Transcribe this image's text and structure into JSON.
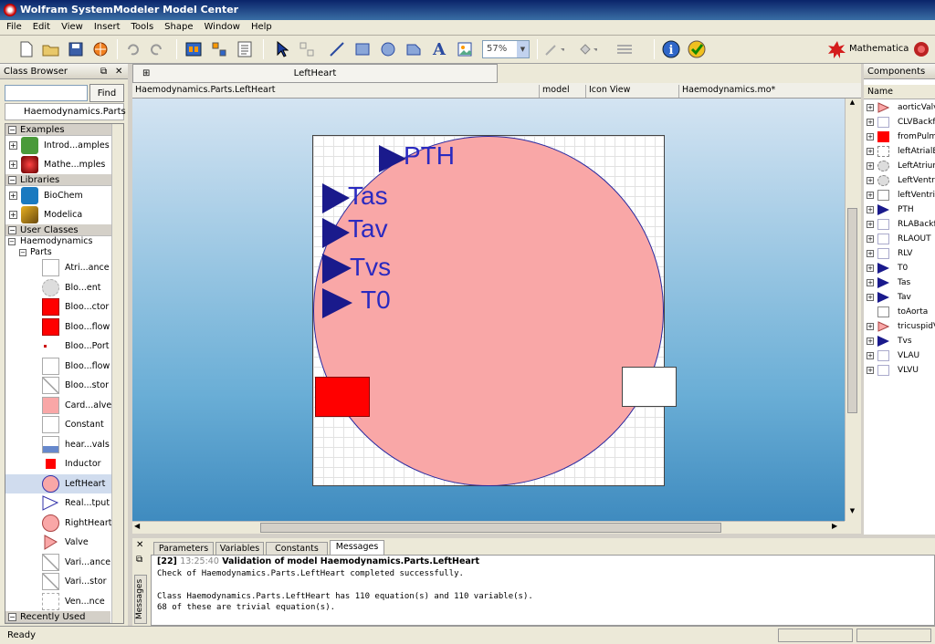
{
  "window": {
    "title": "Wolfram SystemModeler Model Center"
  },
  "menu": [
    "File",
    "Edit",
    "View",
    "Insert",
    "Tools",
    "Shape",
    "Window",
    "Help"
  ],
  "toolbar": {
    "zoom": "57%",
    "mathematica_label": "Mathematica"
  },
  "class_browser": {
    "title": "Class Browser",
    "find_label": "Find",
    "search_value": "",
    "current_path": "Haemodynamics.Parts",
    "groups": {
      "examples": "Examples",
      "libraries": "Libraries",
      "user_classes": "User Classes",
      "recently_used": "Recently Used"
    },
    "examples": [
      "Introd...amples",
      "Mathe...mples"
    ],
    "libraries": [
      "BioChem",
      "Modelica"
    ],
    "tree_root": "Haemodynamics",
    "tree_parts": "Parts",
    "parts": [
      "Atri...ance",
      "Blo...ent",
      "Bloo...ctor",
      "Bloo...flow",
      "Bloo...Port",
      "Bloo...flow",
      "Bloo...stor",
      "Card...alve",
      "Constant",
      "hear...vals",
      "Inductor",
      "LeftHeart",
      "Real...tput",
      "RightHeart",
      "Valve",
      "Vari...ance",
      "Vari...stor",
      "Ven...nce"
    ]
  },
  "editor": {
    "tab": "LeftHeart",
    "path": "Haemodynamics.Parts.LeftHeart",
    "kind": "model",
    "view": "Icon View",
    "file": "Haemodynamics.mo*",
    "labels": [
      "PTH",
      "Tas",
      "Tav",
      "Tvs",
      "T0"
    ]
  },
  "components": {
    "title": "Components",
    "column": "Name",
    "items": [
      "aorticValv",
      "CLVBackfl",
      "fromPulm",
      "leftAtrialE",
      "LeftAtrium",
      "LeftVentri",
      "leftVentric",
      "PTH",
      "RLABackfl",
      "RLAOUT",
      "RLV",
      "T0",
      "Tas",
      "Tav",
      "toAorta",
      "tricuspidV",
      "Tvs",
      "VLAU",
      "VLVU"
    ]
  },
  "messages": {
    "tabs": [
      "Parameters",
      "Variables",
      "Constants",
      "Messages"
    ],
    "side_label": "Messages",
    "entry_id": "[22]",
    "entry_time": "13:25:40",
    "entry_title": "Validation of model Haemodynamics.Parts.LeftHeart",
    "line1": "Check of Haemodynamics.Parts.LeftHeart completed successfully.",
    "line2": "Class Haemodynamics.Parts.LeftHeart has 110 equation(s) and 110 variable(s).",
    "line3": "68 of these are trivial equation(s)."
  },
  "status": {
    "text": "Ready"
  },
  "colors": {
    "accent": "#1a1a8c",
    "heart_fill": "#f9a7a7",
    "red_block": "#ff0000"
  }
}
